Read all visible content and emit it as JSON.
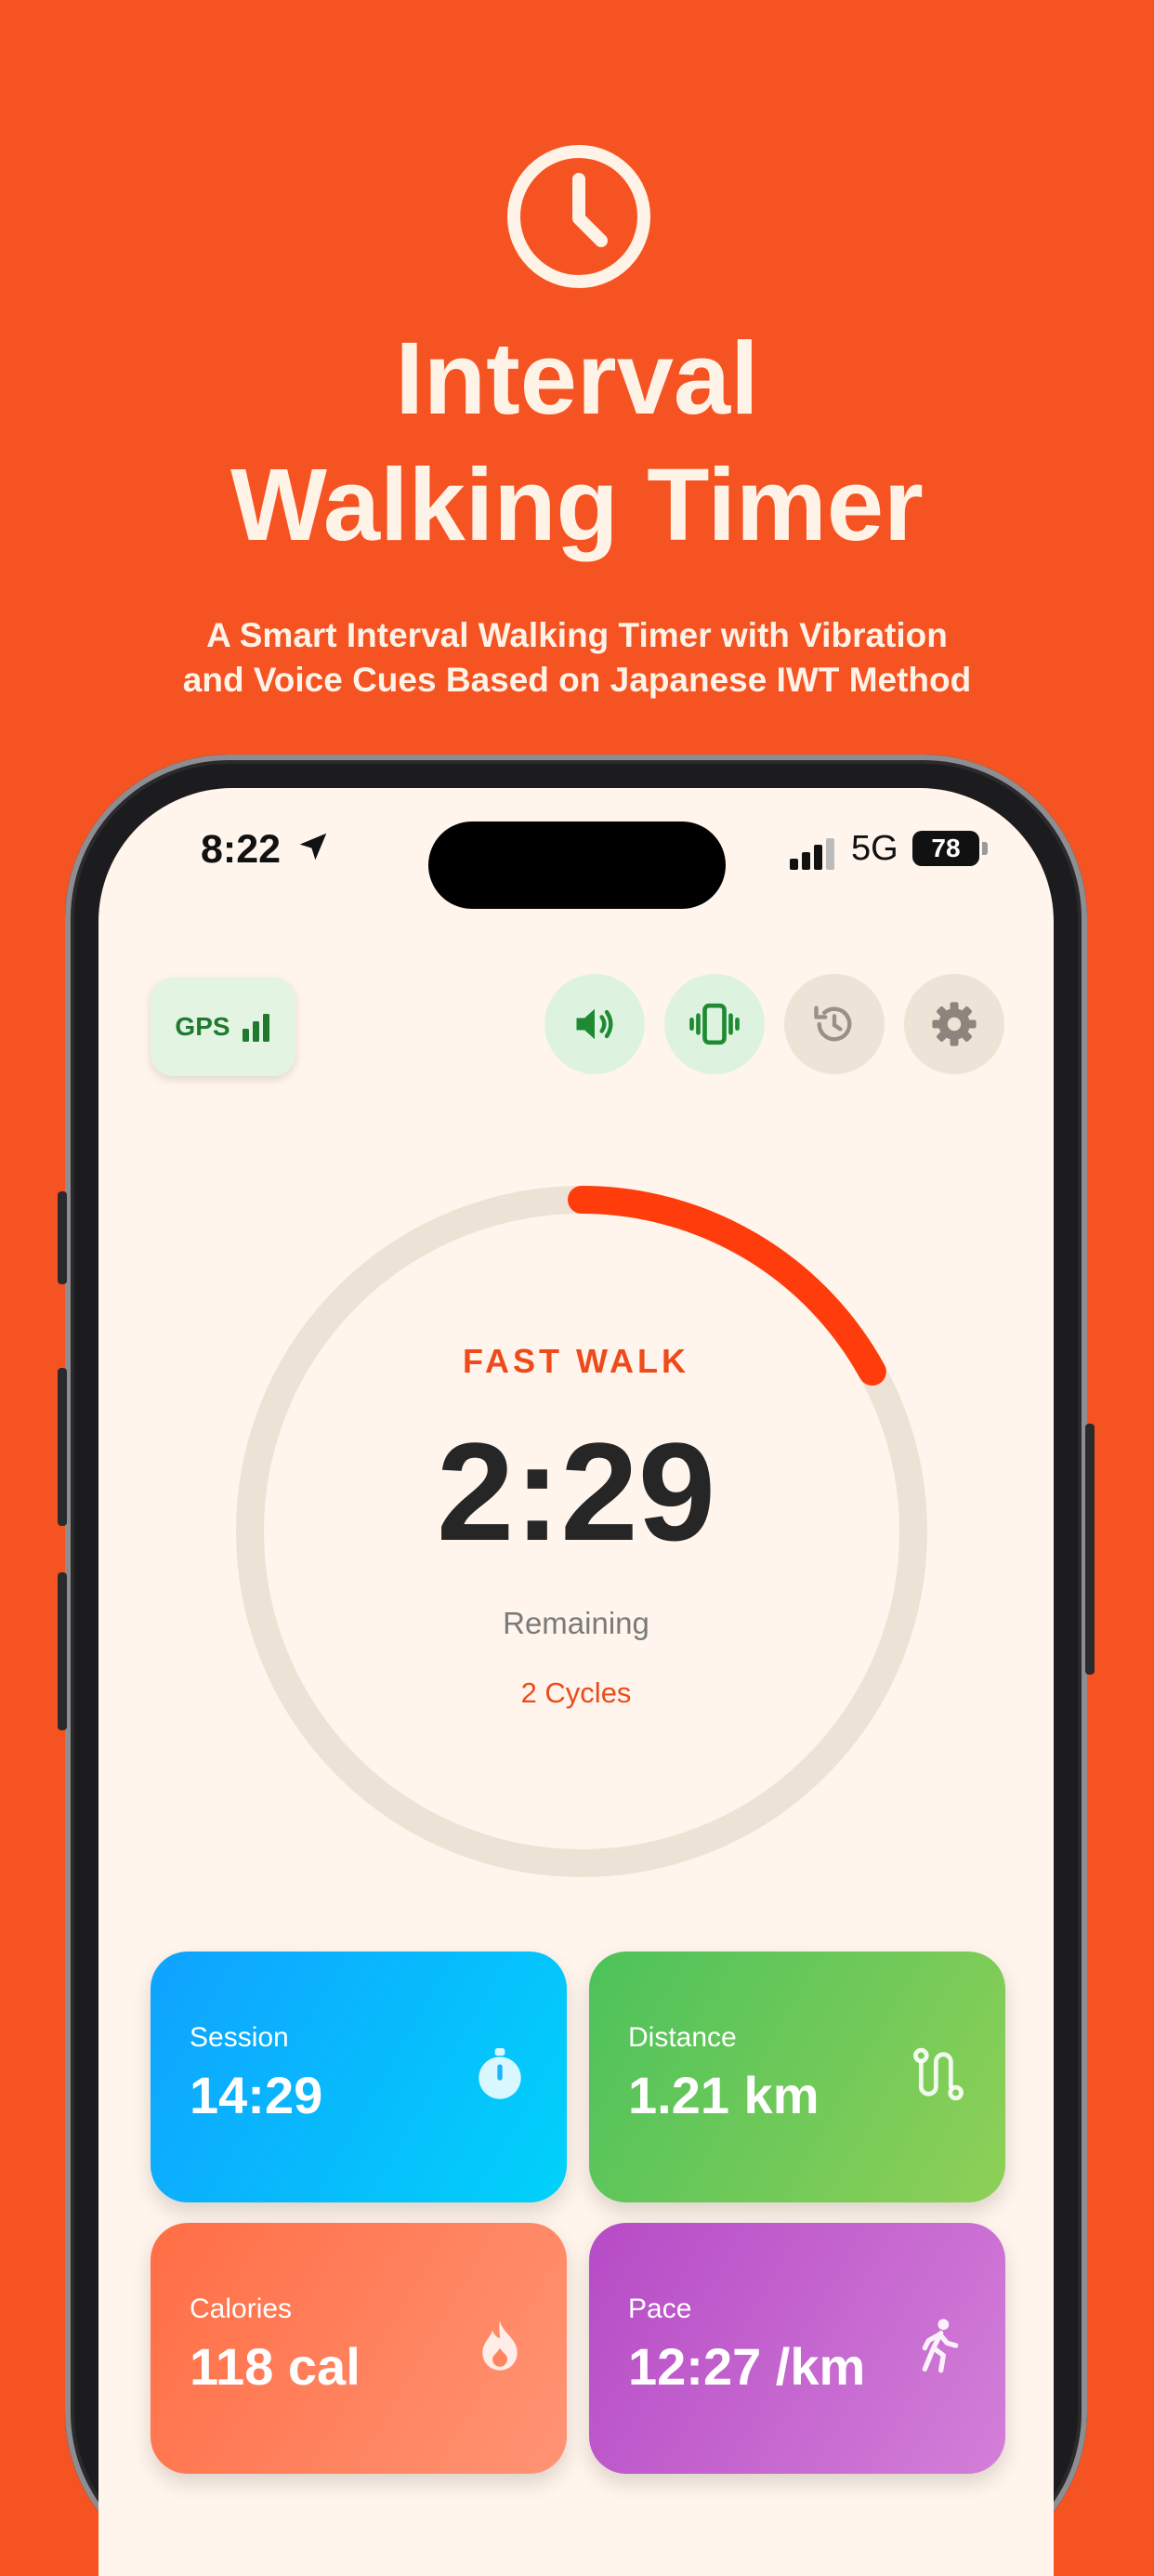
{
  "hero": {
    "icon": "clock-icon",
    "title_line1": "Interval",
    "title_line2": "Walking Timer",
    "subtitle_line1": "A Smart Interval Walking Timer with Vibration",
    "subtitle_line2": "and Voice Cues Based on Japanese IWT Method"
  },
  "status_bar": {
    "time": "8:22",
    "network": "5G",
    "battery": "78"
  },
  "toolbar": {
    "gps_label": "GPS",
    "buttons": [
      "sound-icon",
      "vibration-icon",
      "history-icon",
      "settings-icon"
    ]
  },
  "timer": {
    "mode": "FAST WALK",
    "time": "2:29",
    "remaining_label": "Remaining",
    "cycles": "2 Cycles",
    "progress_fraction": 0.17
  },
  "stats": [
    {
      "label": "Session",
      "value": "14:29",
      "icon": "stopwatch-icon"
    },
    {
      "label": "Distance",
      "value": "1.21 km",
      "icon": "route-icon"
    },
    {
      "label": "Calories",
      "value": "118 cal",
      "icon": "flame-icon"
    },
    {
      "label": "Pace",
      "value": "12:27 /km",
      "icon": "walking-icon"
    }
  ],
  "colors": {
    "background": "#F55322",
    "accent": "#EE4A1A",
    "screen": "#FFF5EC"
  }
}
